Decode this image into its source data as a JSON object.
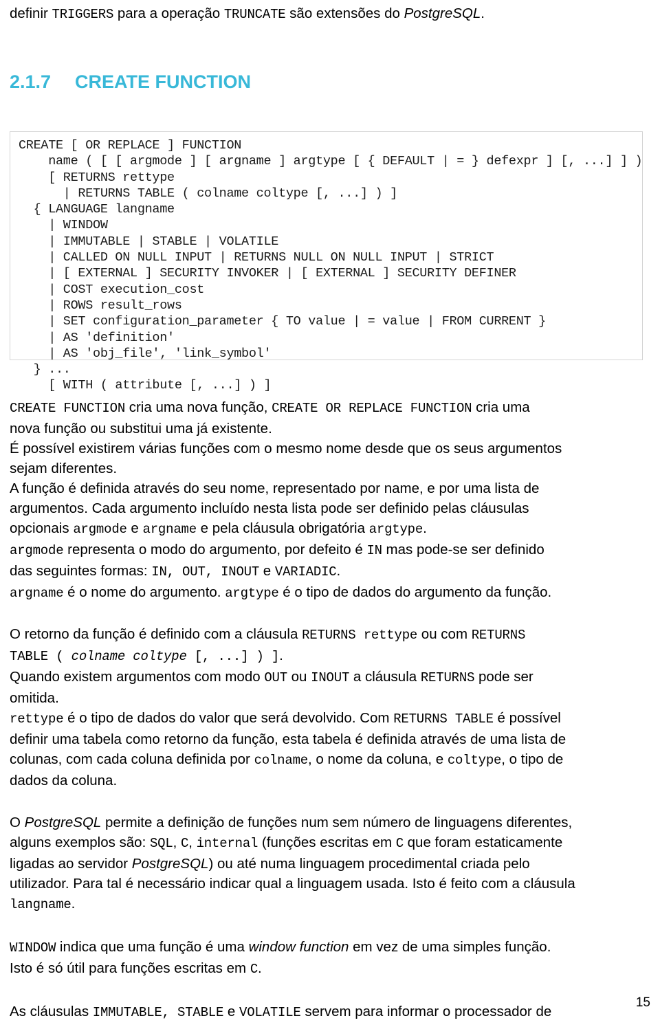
{
  "document": {
    "page_number": "15",
    "heading": {
      "number": "2.1.7",
      "title": "CREATE FUNCTION"
    },
    "accent_color": "#38b8d8",
    "intro_continuation": {
      "t1": "definir ",
      "c1": "TRIGGERS",
      "t2": " para a operação ",
      "c2": "TRUNCATE",
      "t3": " são extensões do ",
      "i1": "PostgreSQL",
      "t4": "."
    },
    "code_block": {
      "language": "sql-synopsis",
      "text": "CREATE [ OR REPLACE ] FUNCTION\n    name ( [ [ argmode ] [ argname ] argtype [ { DEFAULT | = } defexpr ] [, ...] ] )\n    [ RETURNS rettype\n      | RETURNS TABLE ( colname coltype [, ...] ) ]\n  { LANGUAGE langname\n    | WINDOW\n    | IMMUTABLE | STABLE | VOLATILE\n    | CALLED ON NULL INPUT | RETURNS NULL ON NULL INPUT | STRICT\n    | [ EXTERNAL ] SECURITY INVOKER | [ EXTERNAL ] SECURITY DEFINER\n    | COST execution_cost\n    | ROWS result_rows\n    | SET configuration_parameter { TO value | = value | FROM CURRENT }\n    | AS 'definition'\n    | AS 'obj_file', 'link_symbol'\n  } ...\n    [ WITH ( attribute [, ...] ) ]"
    },
    "paragraphs": {
      "p1": {
        "l1a": "CREATE FUNCTION",
        "l1b": " cria uma nova função, ",
        "l1c": "CREATE OR REPLACE FUNCTION",
        "l1d": " cria uma",
        "l2": "nova função ou substitui uma já existente."
      },
      "p2": {
        "l1": "É possível existirem várias funções com o mesmo nome desde que os seus argumentos",
        "l2": "sejam diferentes."
      },
      "p3": {
        "l1": "A função é definida através do seu nome, representado por name, e por uma lista de",
        "l2": "argumentos. Cada argumento incluído nesta lista pode ser definido pelas cláusulas",
        "l3a": "opcionais ",
        "l3b": "argmode",
        "l3c": " e ",
        "l3d": "argname",
        "l3e": " e pela cláusula obrigatória ",
        "l3f": "argtype",
        "l3g": "."
      },
      "p4": {
        "l1a": "argmode",
        "l1b": " representa o modo do argumento, por defeito é ",
        "l1c": "IN",
        "l1d": " mas pode-se ser definido",
        "l2a": "das seguintes formas: ",
        "l2b": "IN, OUT, INOUT",
        "l2c": " e ",
        "l2d": "VARIADIC",
        "l2e": "."
      },
      "p5": {
        "l1a": "argname",
        "l1b": " é o nome do argumento. ",
        "l1c": "argtype",
        "l1d": " é o tipo de dados do argumento da função."
      },
      "p6": {
        "l1a": "O retorno da função é definido com a cláusula ",
        "l1b": "RETURNS rettype",
        "l1c": " ou com ",
        "l1d": "RETURNS",
        "l2a": "TABLE ( ",
        "l2b": "colname coltype",
        "l2c": " [, ...] ) ]",
        "l2d": "."
      },
      "p7": {
        "l1a": "Quando existem argumentos com modo ",
        "l1b": "OUT",
        "l1c": " ou ",
        "l1d": "INOUT",
        "l1e": " a cláusula ",
        "l1f": "RETURNS",
        "l1g": " pode ser",
        "l2": "omitida."
      },
      "p8": {
        "l1a": "rettype",
        "l1b": " é o tipo de dados do valor que será devolvido. Com ",
        "l1c": "RETURNS TABLE",
        "l1d": " é possível",
        "l2": "definir uma tabela como retorno da função, esta tabela é definida através de uma lista de",
        "l3a": "colunas, com cada coluna definida por ",
        "l3b": "colname",
        "l3c": ", o nome da coluna, e ",
        "l3d": "coltype",
        "l3e": ", o tipo de",
        "l4": "dados da coluna."
      },
      "p9": {
        "l1a": "O ",
        "l1b": "PostgreSQL",
        "l1c": " permite a definição de funções num sem número de linguagens diferentes,",
        "l2a": "alguns exemplos são: ",
        "l2b": "SQL",
        "l2c": ", ",
        "l2d": "C",
        "l2e": ", ",
        "l2f": "internal",
        "l2g": " (funções escritas em ",
        "l2h": "C",
        "l2i": " que foram estaticamente",
        "l3a": "ligadas ao servidor ",
        "l3b": "PostgreSQL",
        "l3c": ") ou até numa linguagem procedimental criada pelo",
        "l4": "utilizador. Para tal é necessário indicar qual a linguagem usada. Isto é feito com a cláusula",
        "l5a": "langname",
        "l5b": "."
      },
      "p10": {
        "l1a": "WINDOW",
        "l1b": " indica que uma função é uma ",
        "l1c": "window function",
        "l1d": " em vez de uma simples função.",
        "l2a": "Isto é só útil para funções escritas em ",
        "l2b": "C",
        "l2c": "."
      },
      "p11": {
        "l1a": "As cláusulas ",
        "l1b": "IMMUTABLE, STABLE",
        "l1c": " e ",
        "l1d": "VOLATILE",
        "l1e": " servem para informar o processador de"
      }
    }
  }
}
